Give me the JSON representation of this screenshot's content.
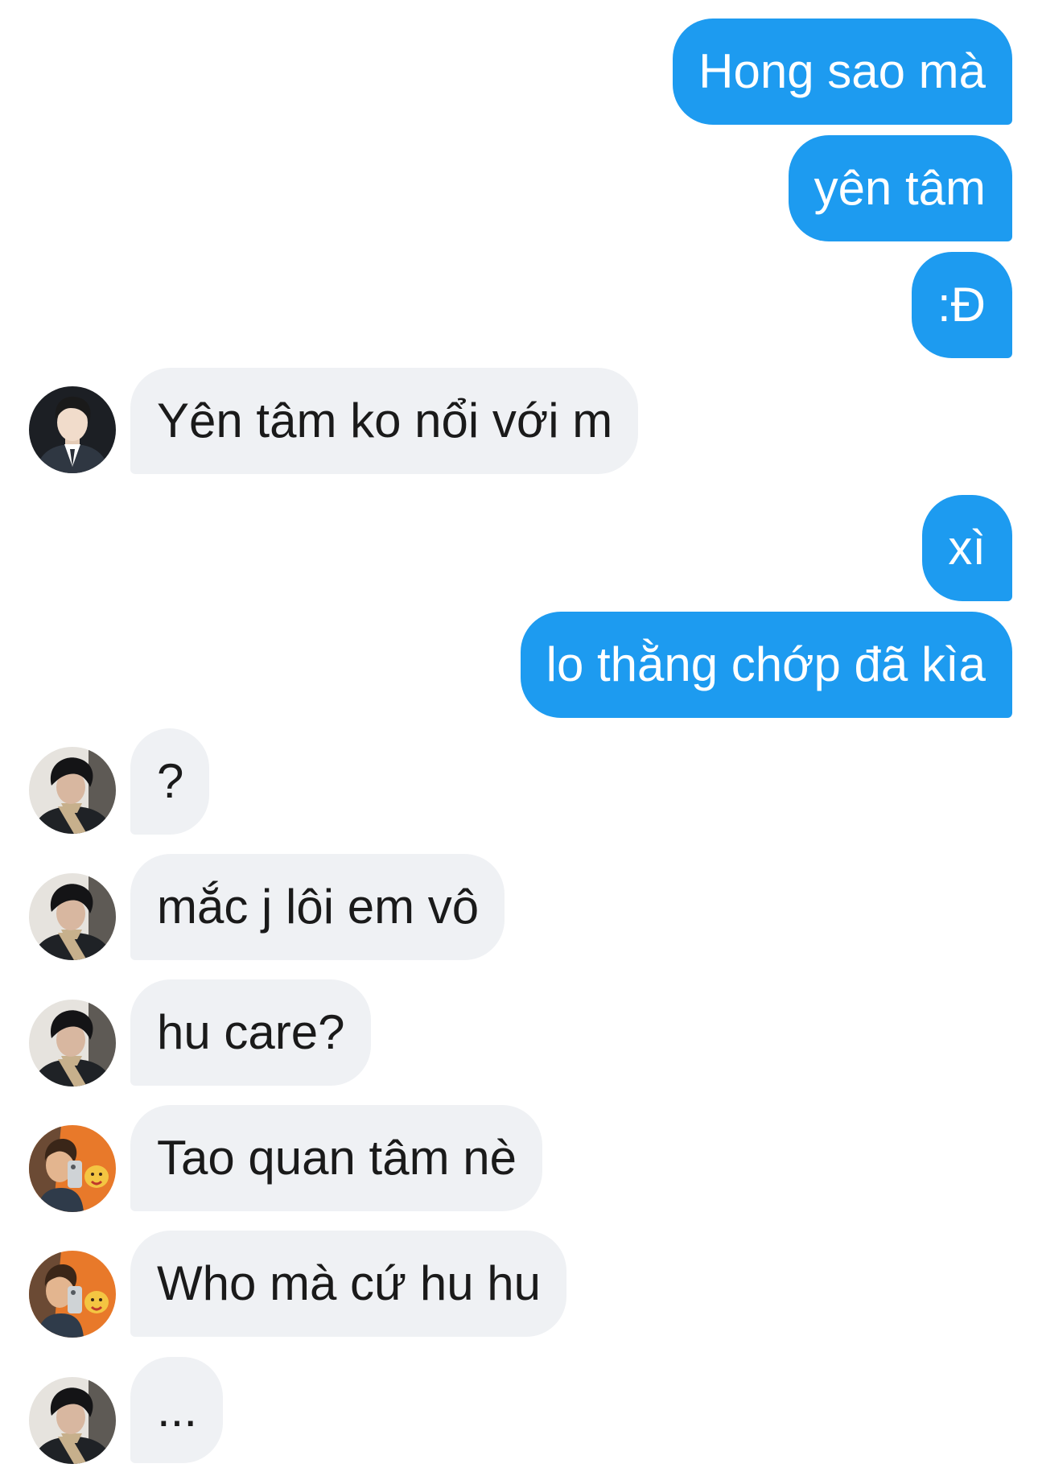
{
  "conversation": {
    "messages": [
      {
        "side": "sent",
        "text": "Hong sao mà"
      },
      {
        "side": "sent",
        "text": "yên tâm"
      },
      {
        "side": "sent",
        "text": ":Đ"
      },
      {
        "side": "received",
        "avatar": "avatar-suit",
        "text": "Yên tâm ko nổi với m"
      },
      {
        "side": "sent",
        "text": "xì"
      },
      {
        "side": "sent",
        "text": "lo thằng chớp đã kìa"
      },
      {
        "side": "received",
        "avatar": "avatar-scarf",
        "text": "?"
      },
      {
        "side": "received",
        "avatar": "avatar-scarf",
        "text": "mắc j lôi em vô"
      },
      {
        "side": "received",
        "avatar": "avatar-scarf",
        "text": "hu care?"
      },
      {
        "side": "received",
        "avatar": "avatar-orange",
        "text": "Tao quan tâm nè"
      },
      {
        "side": "received",
        "avatar": "avatar-orange",
        "text": "Who mà cứ hu hu"
      },
      {
        "side": "received",
        "avatar": "avatar-scarf",
        "text": "..."
      }
    ]
  },
  "colors": {
    "sent_bubble": "#1d9bf0",
    "received_bubble": "#eff1f4",
    "background": "#ffffff"
  }
}
